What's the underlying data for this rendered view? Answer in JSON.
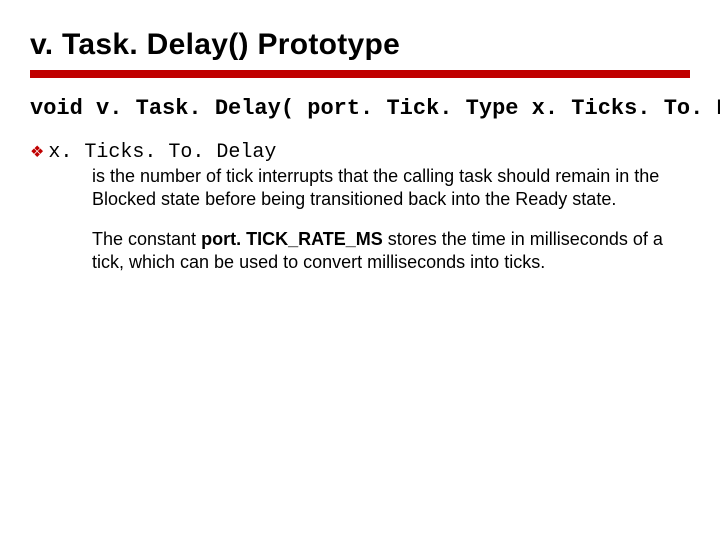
{
  "title_fn": "v. Task. Delay()",
  "title_word": "Prototype",
  "accent_color": "#c00000",
  "signature": "void v. Task. Delay( port. Tick. Type x. Ticks. To. Delay );",
  "param": {
    "name": "x. Ticks. To. Delay",
    "desc1": "is the number of tick interrupts that the calling task should remain in the Blocked state before being transitioned back into the Ready state.",
    "desc2_pre": "The constant ",
    "desc2_const": "port. TICK_RATE_MS",
    "desc2_post": " stores the time in milliseconds of a tick, which can be used to convert milliseconds into ticks."
  }
}
